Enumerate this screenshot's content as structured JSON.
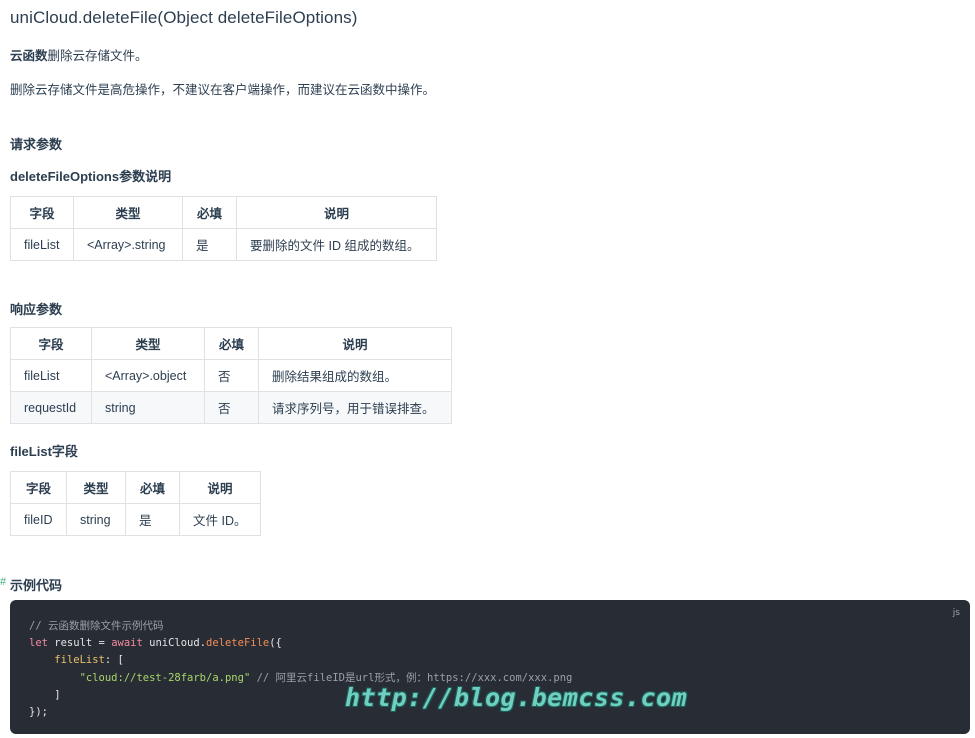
{
  "title": "uniCloud.deleteFile(Object deleteFileOptions)",
  "intro_bold": "云函数",
  "intro_rest": "删除云存储文件。",
  "warning": "删除云存储文件是高危操作，不建议在客户端操作，而建议在云函数中操作。",
  "request_heading": "请求参数",
  "options_heading": "deleteFileOptions参数说明",
  "request_table": {
    "headers": [
      "字段",
      "类型",
      "必填",
      "说明"
    ],
    "rows": [
      [
        "fileList",
        "<Array>.string",
        "是",
        "要删除的文件 ID 组成的数组。"
      ]
    ]
  },
  "response_heading": "响应参数",
  "response_table": {
    "headers": [
      "字段",
      "类型",
      "必填",
      "说明"
    ],
    "rows": [
      [
        "fileList",
        "<Array>.object",
        "否",
        "删除结果组成的数组。"
      ],
      [
        "requestId",
        "string",
        "否",
        "请求序列号，用于错误排查。"
      ]
    ]
  },
  "filelist_heading": "fileList字段",
  "filelist_table": {
    "headers": [
      "字段",
      "类型",
      "必填",
      "说明"
    ],
    "rows": [
      [
        "fileID",
        "string",
        "是",
        "文件 ID。"
      ]
    ]
  },
  "example_anchor": "#",
  "example_heading": "示例代码",
  "code": {
    "lang": "js",
    "comment1": "// 云函数删除文件示例代码",
    "kw_let": "let",
    "var_result": " result = ",
    "kw_await": "await",
    "obj": " uniCloud.",
    "fn": "deleteFile",
    "open": "({",
    "indent1": "    ",
    "prop": "fileList",
    "prop_rest": ": [",
    "indent2": "        ",
    "str": "\"cloud://test-28farb/a.png\"",
    "comment2": " // 阿里云fileID是url形式，例：https://xxx.com/xxx.png",
    "close_arr": "    ]",
    "close_obj": "});"
  },
  "watermark": "http://blog.bemcss.com",
  "colors": {
    "accent": "#3eaf7c",
    "code_bg": "#282c34",
    "border": "#dfe2e5"
  }
}
